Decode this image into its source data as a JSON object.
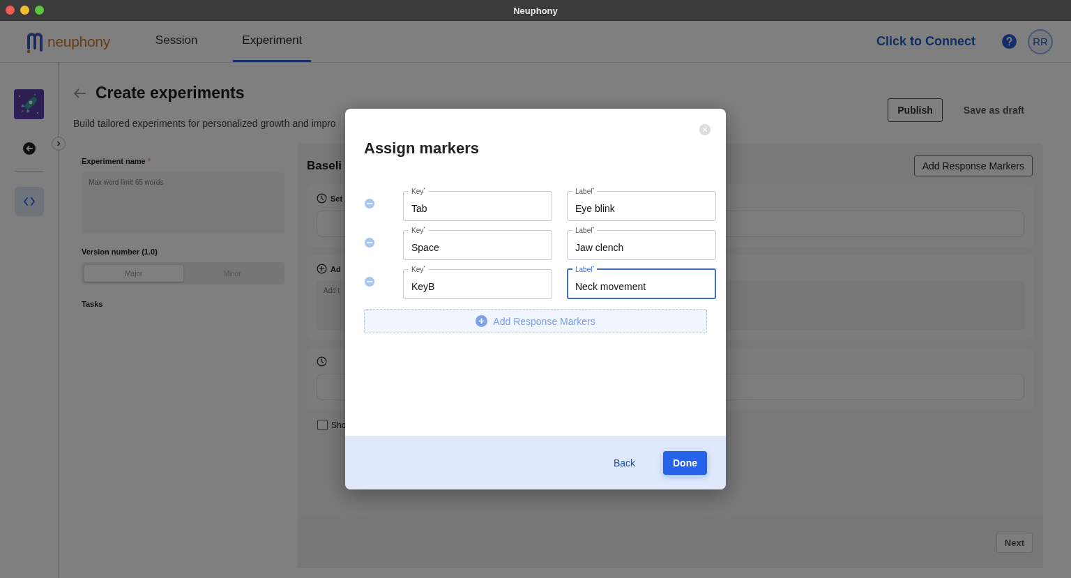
{
  "window": {
    "title": "Neuphony"
  },
  "header": {
    "logo_text": "neuphony",
    "tabs": [
      {
        "label": "Session",
        "selected": false
      },
      {
        "label": "Experiment",
        "selected": true
      }
    ],
    "connect_link": "Click to Connect",
    "avatar": "RR"
  },
  "page": {
    "title": "Create experiments",
    "subtitle": "Build tailored experiments for personalized growth and impro",
    "publish_button": "Publish",
    "draft_button": "Save as draft"
  },
  "form": {
    "name_label": "Experiment name",
    "required_mark": "*",
    "name_placeholder": "Max word limit 65 words",
    "version_label": "Version number (1.0)",
    "version_options": [
      {
        "label": "Major",
        "selected": true
      },
      {
        "label": "Minor",
        "selected": false
      }
    ],
    "tasks_label": "Tasks"
  },
  "baseline": {
    "title": "Baseli",
    "add_button": "Add Response Markers",
    "sections": [
      {
        "kind": "timer",
        "label": "Set"
      },
      {
        "kind": "task",
        "label": "Ad",
        "placeholder": "Add t"
      },
      {
        "kind": "timer"
      }
    ],
    "checkbox": {
      "label": "Sho",
      "checked": false
    },
    "next_button": "Next"
  },
  "modal": {
    "title": "Assign markers",
    "markers": [
      {
        "key_caption": "Key$^{*}$",
        "key": "Tab",
        "label_caption": "Label$^{*}$",
        "label": "Eye blink",
        "focused": false
      },
      {
        "key_caption": "Key$^{*}$",
        "key": "Space",
        "label_caption": "Label$^{*}$",
        "label": "Jaw clench",
        "focused": false
      },
      {
        "key_caption": "Key$^{*}$",
        "key": "KeyB",
        "label_caption": "Label$^{*}$",
        "label": "Neck movement",
        "focused": true
      }
    ],
    "add_button": "Add Response Markers",
    "back_button": "Back",
    "done_button": "Done"
  }
}
